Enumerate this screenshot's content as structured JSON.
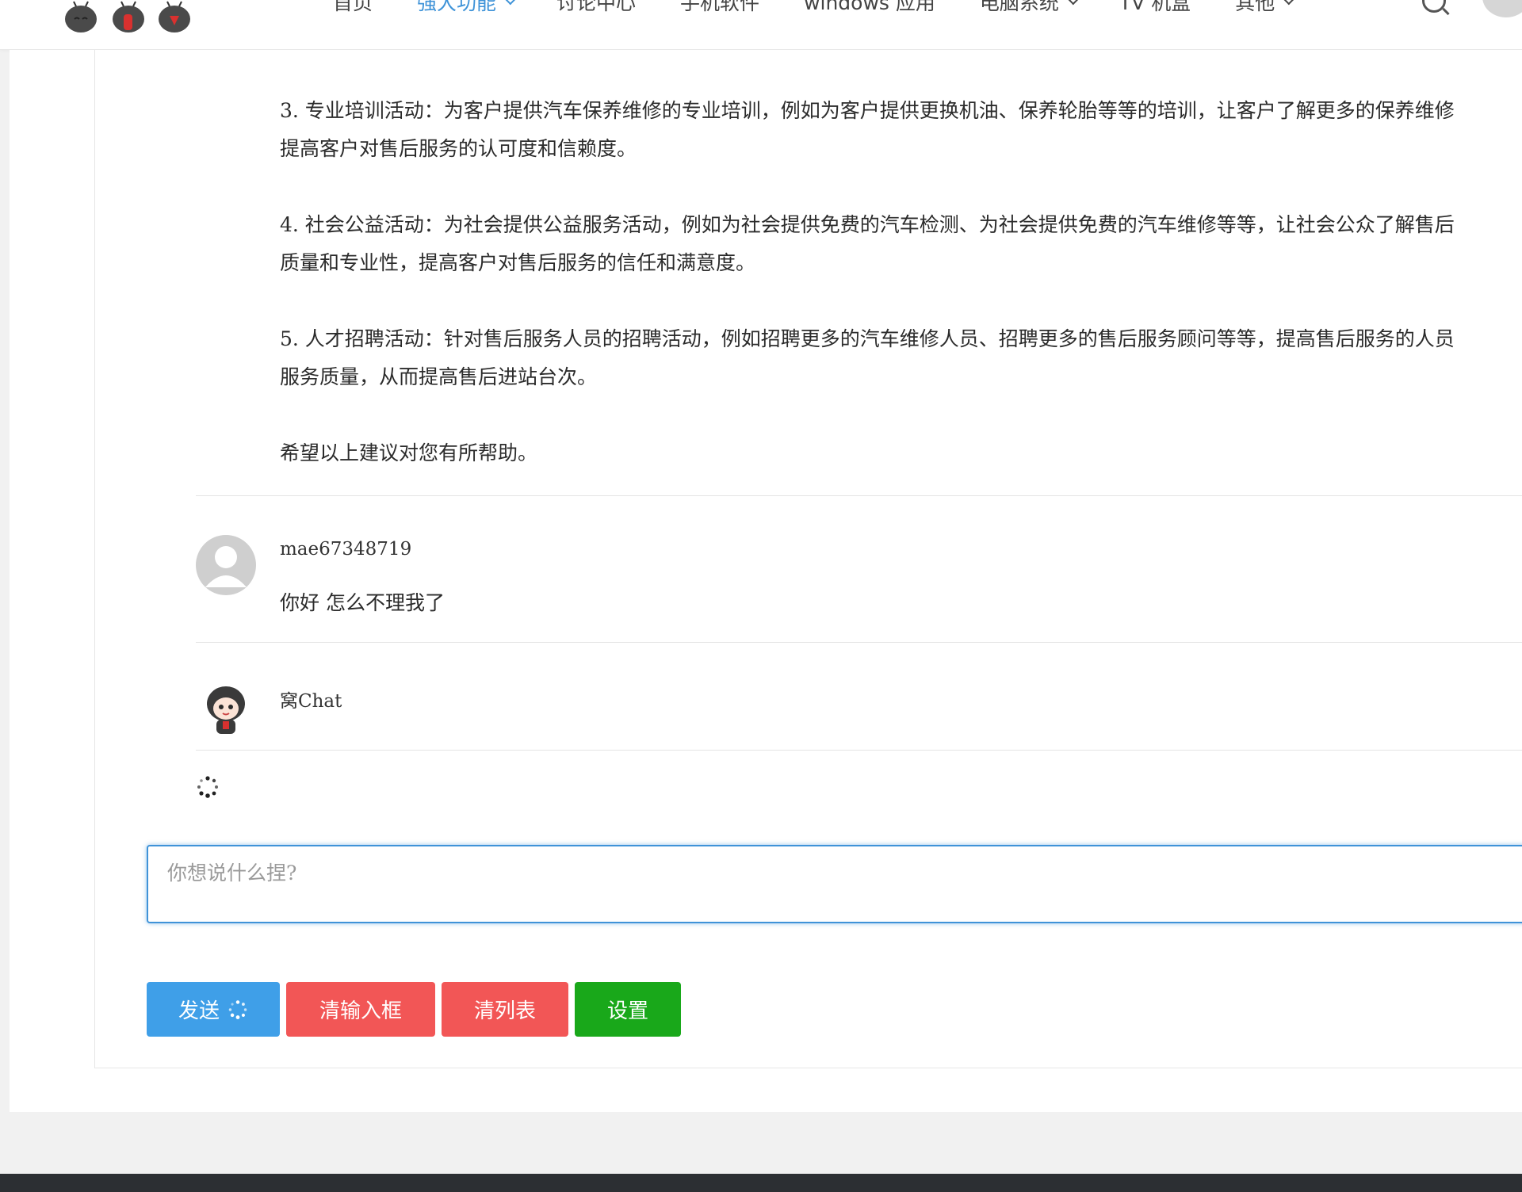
{
  "nav": {
    "items": [
      {
        "label": "首页",
        "active": false,
        "has_dropdown": false
      },
      {
        "label": "强大功能",
        "active": true,
        "has_dropdown": true
      },
      {
        "label": "讨论中心",
        "active": false,
        "has_dropdown": false
      },
      {
        "label": "手机软件",
        "active": false,
        "has_dropdown": false
      },
      {
        "label": "windows 应用",
        "active": false,
        "has_dropdown": false
      },
      {
        "label": "电脑系统",
        "active": false,
        "has_dropdown": true
      },
      {
        "label": "TV 机盒",
        "active": false,
        "has_dropdown": false
      },
      {
        "label": "其他",
        "active": false,
        "has_dropdown": true
      }
    ],
    "accent_color": "#3f93d8"
  },
  "answer": {
    "p3": {
      "line1": "3. 专业培训活动：为客户提供汽车保养维修的专业培训，例如为客户提供更换机油、保养轮胎等等的培训，让客户了解更多的保养维修",
      "line2": "提高客户对售后服务的认可度和信赖度。"
    },
    "p4": {
      "line1": "4. 社会公益活动：为社会提供公益服务活动，例如为社会提供免费的汽车检测、为社会提供免费的汽车维修等等，让社会公众了解售后",
      "line2": "质量和专业性，提高客户对售后服务的信任和满意度。"
    },
    "p5": {
      "line1": "5. 人才招聘活动：针对售后服务人员的招聘活动，例如招聘更多的汽车维修人员、招聘更多的售后服务顾问等等，提高售后服务的人员",
      "line2": "服务质量，从而提高售后进站台次。"
    },
    "closing": "希望以上建议对您有所帮助。"
  },
  "messages": [
    {
      "author": "mae67348719",
      "text": "你好 怎么不理我了",
      "avatar": "default-user-avatar"
    },
    {
      "author": "窝Chat",
      "text": "",
      "avatar": "chat-bot-avatar"
    }
  ],
  "input": {
    "placeholder": "你想说什么捏?",
    "value": ""
  },
  "buttons": {
    "send": "发送",
    "clear_input": "清输入框",
    "clear_list": "清列表",
    "settings": "设置"
  },
  "colors": {
    "send": "#3f9fe8",
    "danger": "#f25656",
    "settings": "#19a81a",
    "footer": "#2c2f33"
  }
}
